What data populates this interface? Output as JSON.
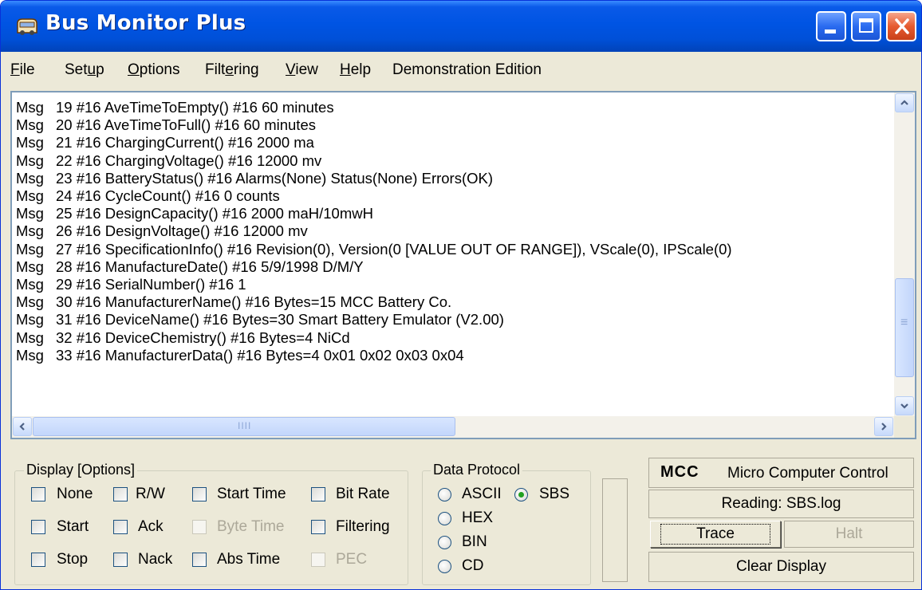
{
  "window": {
    "title": "Bus Monitor Plus"
  },
  "menu": [
    {
      "pre": "",
      "u": "F",
      "post": "ile"
    },
    {
      "pre": "Set",
      "u": "u",
      "post": "p"
    },
    {
      "pre": "",
      "u": "O",
      "post": "ptions"
    },
    {
      "pre": "Filt",
      "u": "e",
      "post": "ring"
    },
    {
      "pre": "",
      "u": "V",
      "post": "iew"
    },
    {
      "pre": "",
      "u": "H",
      "post": "elp"
    },
    {
      "pre": "Demonstration Edition",
      "u": "",
      "post": ""
    }
  ],
  "log": [
    {
      "type": "Msg",
      "text": "19 #16 AveTimeToEmpty() #16 60 minutes"
    },
    {
      "type": "Msg",
      "text": "20 #16 AveTimeToFull() #16 60 minutes"
    },
    {
      "type": "Msg",
      "text": "21 #16 ChargingCurrent() #16 2000 ma"
    },
    {
      "type": "Msg",
      "text": "22 #16 ChargingVoltage() #16 12000 mv"
    },
    {
      "type": "Msg",
      "text": "23 #16 BatteryStatus() #16 Alarms(None) Status(None) Errors(OK)"
    },
    {
      "type": "Msg",
      "text": "24 #16 CycleCount() #16 0 counts"
    },
    {
      "type": "Msg",
      "text": "25 #16 DesignCapacity() #16 2000 maH/10mwH"
    },
    {
      "type": "Msg",
      "text": "26 #16 DesignVoltage() #16 12000 mv"
    },
    {
      "type": "Msg",
      "text": "27 #16 SpecificationInfo() #16 Revision(0), Version(0 [VALUE OUT OF RANGE]), VScale(0), IPScale(0)"
    },
    {
      "type": "Msg",
      "text": "28 #16 ManufactureDate() #16 5/9/1998 D/M/Y"
    },
    {
      "type": "Msg",
      "text": "29 #16 SerialNumber() #16 1"
    },
    {
      "type": "Msg",
      "text": "30 #16 ManufacturerName() #16 Bytes=15 MCC Battery Co."
    },
    {
      "type": "Msg",
      "text": "31 #16 DeviceName() #16 Bytes=30 Smart Battery Emulator (V2.00)"
    },
    {
      "type": "Msg",
      "text": "32 #16 DeviceChemistry() #16 Bytes=4 NiCd"
    },
    {
      "type": "Msg",
      "text": "33 #16 ManufacturerData() #16 Bytes=4  0x01 0x02 0x03 0x04"
    }
  ],
  "scroll": {
    "hthumb_grip": "IIII",
    "vthumb_grip": "≡"
  },
  "display_options": {
    "label": "Display [Options]",
    "items": [
      {
        "label": "None",
        "checked": false,
        "enabled": true
      },
      {
        "label": "R/W",
        "checked": false,
        "enabled": true
      },
      {
        "label": "Start Time",
        "checked": false,
        "enabled": true
      },
      {
        "label": "Bit Rate",
        "checked": false,
        "enabled": true
      },
      {
        "label": "Start",
        "checked": false,
        "enabled": true
      },
      {
        "label": "Ack",
        "checked": false,
        "enabled": true
      },
      {
        "label": "Byte Time",
        "checked": false,
        "enabled": false
      },
      {
        "label": "Filtering",
        "checked": false,
        "enabled": true
      },
      {
        "label": "Stop",
        "checked": false,
        "enabled": true
      },
      {
        "label": "Nack",
        "checked": false,
        "enabled": true
      },
      {
        "label": "Abs Time",
        "checked": false,
        "enabled": true
      },
      {
        "label": "PEC",
        "checked": false,
        "enabled": false
      }
    ]
  },
  "data_protocol": {
    "label": "Data Protocol",
    "options": [
      "ASCII",
      "SBS",
      "HEX",
      "BIN",
      "CD"
    ],
    "selected": "SBS"
  },
  "control": {
    "logo": "MCC",
    "company": "Micro Computer Control",
    "status": "Reading: SBS.log",
    "trace_label": "Trace",
    "halt_label": "Halt",
    "clear_label": "Clear Display"
  },
  "colors": {
    "titlebar": "#0054e3",
    "face": "#ece9d8",
    "log_border": "#7f9db9",
    "disabled_text": "#aca899"
  }
}
